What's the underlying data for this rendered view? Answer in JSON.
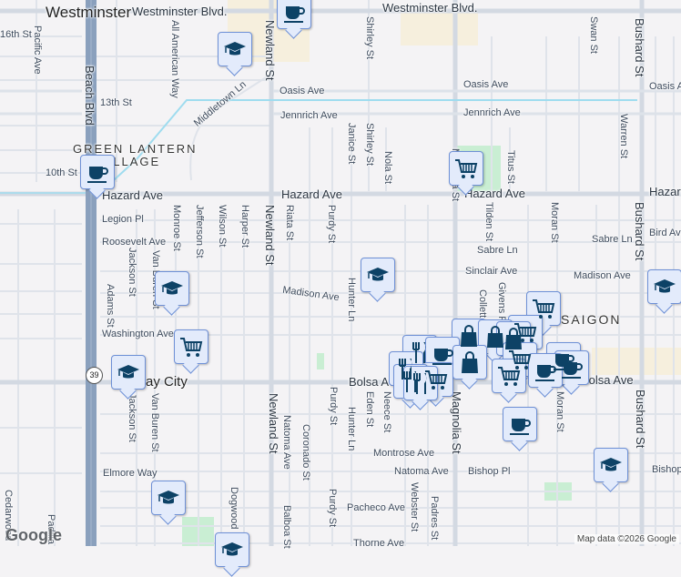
{
  "map": {
    "city": "Westminster",
    "neighborhood_1": "GREEN LANTERN",
    "neighborhood_2": "VILLAGE",
    "neighborhood_3": "SAIGON",
    "midway": "Midway City",
    "route": "39",
    "logo": "Google",
    "attribution": "Map data ©2026 Google"
  },
  "labels": {
    "westminster_blvd_1": "Westminster Blvd.",
    "westminster_blvd_2": "Westminster Blvd.",
    "st16": "16th St",
    "pacific": "Pacific Ave",
    "all_american": "All American Way",
    "newland_1": "Newland St",
    "shirley_1": "Shirley St",
    "swan": "Swan St",
    "bushard_1": "Bushard St",
    "oasis_1": "Oasis Ave",
    "oasis_2": "Oasis Ave",
    "oasis_3": "Oasis Ave",
    "st13": "13th St",
    "beach": "Beach Blvd",
    "middletown": "Middletown Ln",
    "jennrich_1": "Jennrich Ave",
    "jennrich_2": "Jennrich Ave",
    "janice": "Janice St",
    "shirley_2": "Shirley St",
    "nola": "Nola St",
    "titus": "Titus St",
    "warren": "Warren St",
    "st10": "10th St",
    "hazard_1": "Hazard Ave",
    "hazard_2": "Hazard Ave",
    "hazard_3": "Hazard Ave",
    "hazard_4": "Hazard Ave",
    "legion": "Legion Pl",
    "roosevelt": "Roosevelt Ave",
    "monroe": "Monroe St",
    "jefferson": "Jefferson St",
    "wilson": "Wilson St",
    "harper": "Harper St",
    "newland_2": "Newland St",
    "riata": "Riata St",
    "purdy_1": "Purdy St",
    "magnolia_1": "Magnolia St",
    "tilden": "Tilden St",
    "moran_1": "Moran St",
    "bushard_2": "Bushard St",
    "bird": "Bird Ave",
    "sabre_1": "Sabre Ln",
    "sabre_2": "Sabre Ln",
    "sinclair": "Sinclair Ave",
    "madison_1": "Madison Ave",
    "madison_2": "Madison Ave",
    "hunter_1": "Hunter Ln",
    "collett": "Collett St",
    "givens": "Givens Pl",
    "jackson_1": "Jackson St",
    "van_buren_1": "Van Buren St",
    "adams": "Adams St",
    "washington": "Washington Ave",
    "bolsa_1": "Bolsa Ave",
    "bolsa_2": "Bolsa Ave",
    "eden": "Eden St",
    "neece": "Neece St",
    "magnolia_2": "Magnolia St",
    "moran_2": "Moran St",
    "bushard_3": "Bushard St",
    "hunter_2": "Hunter Ln",
    "purdy_2": "Purdy St",
    "jackson_2": "Jackson St",
    "van_buren_2": "Van Buren St",
    "newland_3": "Newland St",
    "natoma_1": "Natoma Ave",
    "coronado": "Coronado St",
    "montrose": "Montrose Ave",
    "natoma_2": "Natoma Ave",
    "bishop_1": "Bishop Pl",
    "bishop_2": "Bishop Pl",
    "elmore": "Elmore Way",
    "dogwood": "Dogwood",
    "balboa": "Balboa St",
    "webster": "Webster St",
    "padres": "Padres St",
    "pacheco": "Pacheco Ave",
    "thorne": "Thorne Ave",
    "purdy_3": "Purdy St",
    "cedarwood": "Cedarwood",
    "padi": "Padilla"
  },
  "colors": {
    "marker_bg": "#e3ebfb",
    "marker_border": "#6e90d6",
    "icon": "#0d4266",
    "highway": "#8aa0bd",
    "canal": "#9fdcef",
    "park": "#c9eed3",
    "commercial": "#f6efdd"
  }
}
